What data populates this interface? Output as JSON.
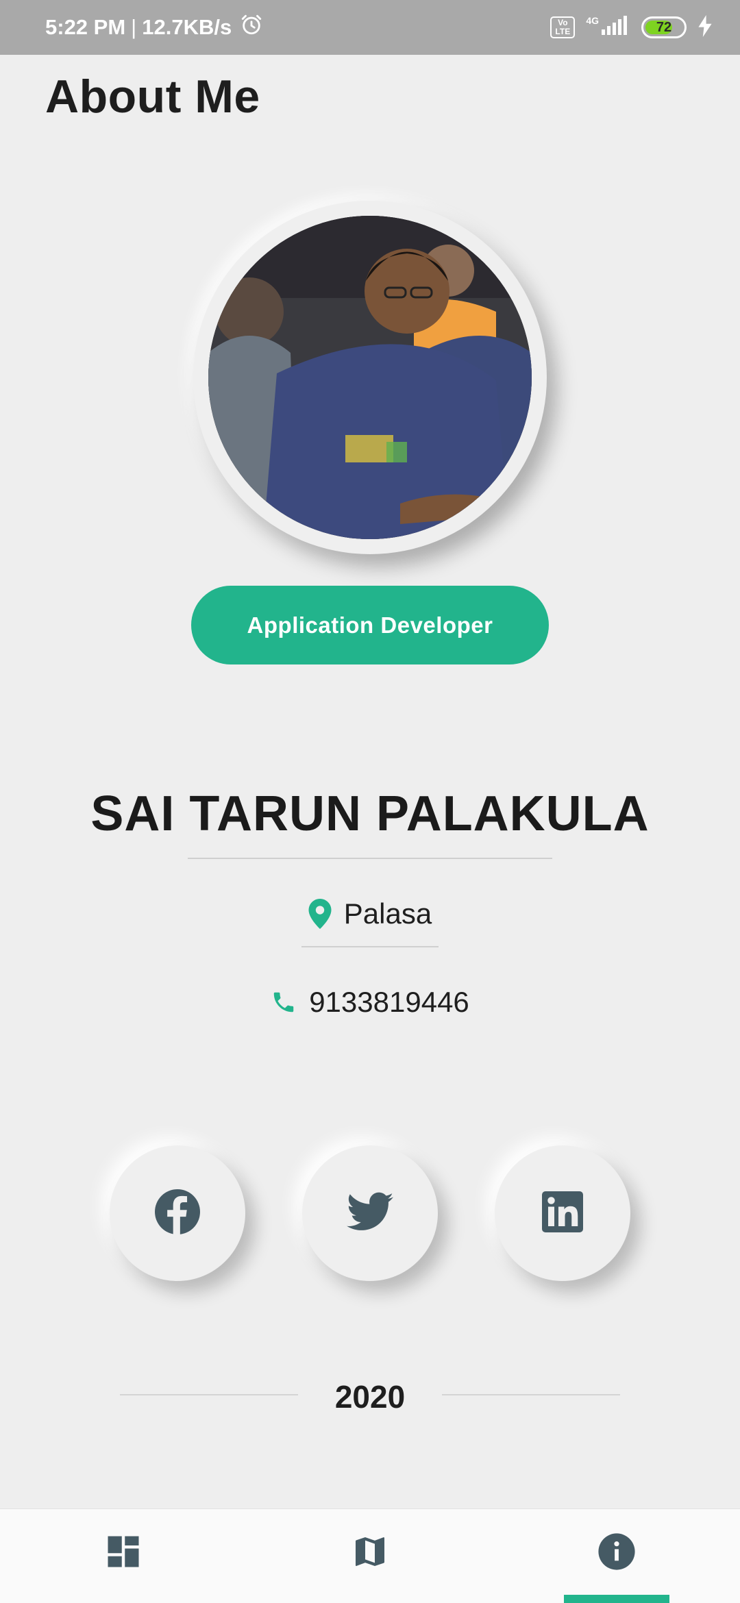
{
  "status_bar": {
    "time": "5:22 PM",
    "separator": "|",
    "net_speed": "12.7KB/s",
    "volte_line1": "Vo",
    "volte_line2": "LTE",
    "network": "4G",
    "battery_level": "72",
    "battery_fraction": 0.72
  },
  "header": {
    "title": "About Me"
  },
  "profile": {
    "role": "Application Developer",
    "name": "SAI TARUN PALAKULA",
    "location": "Palasa",
    "phone": "9133819446"
  },
  "social": {
    "items": [
      {
        "icon": "facebook-icon"
      },
      {
        "icon": "twitter-icon"
      },
      {
        "icon": "linkedin-icon"
      }
    ]
  },
  "footer": {
    "year": "2020"
  },
  "bottom_nav": {
    "items": [
      {
        "icon": "dashboard-icon"
      },
      {
        "icon": "map-icon"
      },
      {
        "icon": "info-icon",
        "active": true
      }
    ]
  },
  "colors": {
    "accent": "#22b48c",
    "background": "#eeeeee",
    "icon": "#455a64",
    "status_bar": "#a9a9a9"
  }
}
